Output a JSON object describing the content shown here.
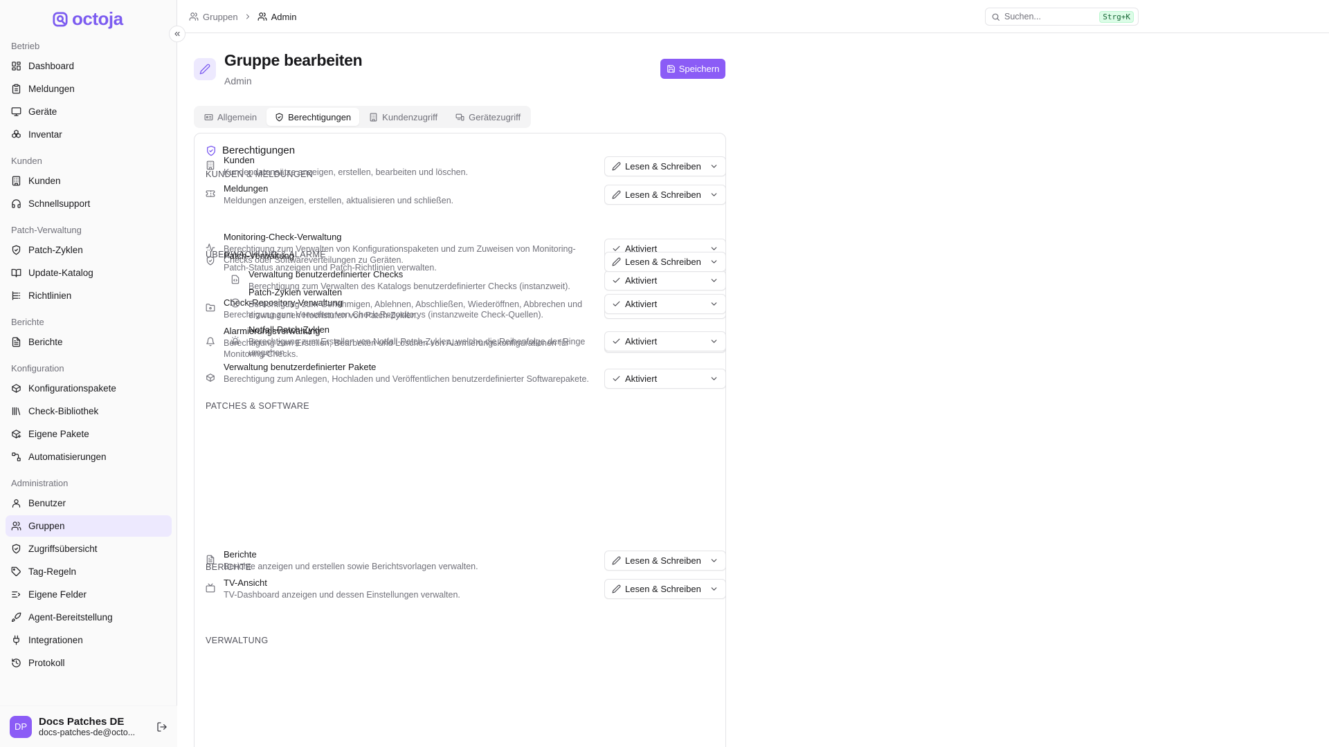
{
  "app": {
    "logo": "octoja"
  },
  "sidebar": {
    "sections": [
      {
        "title": "Betrieb",
        "items": [
          {
            "label": "Dashboard",
            "icon": "dashboard-icon"
          },
          {
            "label": "Meldungen",
            "icon": "clipboard-icon"
          },
          {
            "label": "Geräte",
            "icon": "monitor-icon"
          },
          {
            "label": "Inventar",
            "icon": "boxes-icon"
          }
        ]
      },
      {
        "title": "Kunden",
        "items": [
          {
            "label": "Kunden",
            "icon": "building-icon"
          },
          {
            "label": "Schnellsupport",
            "icon": "headset-icon"
          }
        ]
      },
      {
        "title": "Patch-Verwaltung",
        "items": [
          {
            "label": "Patch-Zyklen",
            "icon": "shield-icon"
          },
          {
            "label": "Update-Katalog",
            "icon": "book-icon"
          },
          {
            "label": "Richtlinien",
            "icon": "list-icon"
          }
        ]
      },
      {
        "title": "Berichte",
        "items": [
          {
            "label": "Berichte",
            "icon": "report-icon"
          }
        ]
      },
      {
        "title": "Konfiguration",
        "items": [
          {
            "label": "Konfigurationspakete",
            "icon": "package-icon"
          },
          {
            "label": "Check-Bibliothek",
            "icon": "library-icon"
          },
          {
            "label": "Eigene Pakete",
            "icon": "package-plus-icon"
          },
          {
            "label": "Automatisierungen",
            "icon": "workflow-icon"
          }
        ]
      },
      {
        "title": "Administration",
        "items": [
          {
            "label": "Benutzer",
            "icon": "user-icon"
          },
          {
            "label": "Gruppen",
            "icon": "users-icon",
            "active": true
          },
          {
            "label": "Zugriffsübersicht",
            "icon": "shield-icon"
          },
          {
            "label": "Tag-Regeln",
            "icon": "tag-icon"
          },
          {
            "label": "Eigene Felder",
            "icon": "fields-icon"
          },
          {
            "label": "Agent-Bereitstellung",
            "icon": "rocket-icon"
          },
          {
            "label": "Integrationen",
            "icon": "plug-icon"
          },
          {
            "label": "Protokoll",
            "icon": "history-icon"
          }
        ]
      }
    ],
    "user": {
      "initials": "DP",
      "name": "Docs Patches DE",
      "email": "docs-patches-de@octo..."
    }
  },
  "topbar": {
    "breadcrumb": [
      "Gruppen",
      "Admin"
    ],
    "search": {
      "placeholder": "Suchen...",
      "shortcut": "Strg+K"
    }
  },
  "header": {
    "title": "Gruppe bearbeiten",
    "subtitle": "Admin",
    "save_label": "Speichern"
  },
  "tabs": [
    {
      "label": "Allgemein",
      "icon": "id-card-icon"
    },
    {
      "label": "Berechtigungen",
      "icon": "shield-check-icon",
      "active": true
    },
    {
      "label": "Kundenzugriff",
      "icon": "building-icon"
    },
    {
      "label": "Gerätezugriff",
      "icon": "devices-icon"
    }
  ],
  "permissions": {
    "title": "Berechtigungen",
    "sections": [
      {
        "title": "KUNDEN & MELDUNGEN",
        "rows": [
          {
            "name": "Kunden",
            "desc": "Kundendatensätze anzeigen, erstellen, bearbeiten und löschen.",
            "value": "Lesen & Schreiben",
            "icon": "building-icon"
          },
          {
            "name": "Meldungen",
            "desc": "Meldungen anzeigen, erstellen, aktualisieren und schließen.",
            "value": "Lesen & Schreiben",
            "icon": "ticket-icon"
          }
        ]
      },
      {
        "title": "ÜBERWACHUNG & ALARME",
        "rows": [
          {
            "name": "Monitoring-Check-Verwaltung",
            "desc": "Berechtigung zum Verwalten von Konfigurationspaketen und zum Zuweisen von Monitoring-Checks oder Softwareverteilungen zu Geräten.",
            "value": "Aktiviert",
            "icon": "activity-icon"
          },
          {
            "name": "Verwaltung benutzerdefinierter Checks",
            "desc": "Berechtigung zum Verwalten des Katalogs benutzerdefinierter Checks (instanzweit).",
            "value": "Aktiviert",
            "icon": "file-code-icon",
            "sub": true
          },
          {
            "name": "Check-Repository-Verwaltung",
            "desc": "Berechtigung zum Verwalten von Check-Repositorys (instanzweite Check-Quellen).",
            "value": "Aktiviert",
            "icon": "folder-git-icon"
          },
          {
            "name": "Alarmierungsverwaltung",
            "desc": "Berechtigung zum Erstellen, Bearbeiten und Löschen von Alarmierungskonfigurationen für Monitoring-Checks.",
            "value": "Aktiviert",
            "icon": "bell-icon"
          }
        ]
      },
      {
        "title": "PATCHES & SOFTWARE",
        "rows": [
          {
            "name": "Patch-Verwaltung",
            "desc": "Patch-Status anzeigen und Patch-Richtlinien verwalten.",
            "value": "Lesen & Schreiben",
            "icon": "shield-icon"
          },
          {
            "name": "Patch-Zyklen verwalten",
            "desc": "Berechtigung zum Genehmigen, Ablehnen, Abschließen, Wiederöffnen, Abbrechen und erzwungenen Hochstufen von Patch-Zyklen.",
            "value": "Aktiviert",
            "icon": "circle-check-icon",
            "sub": true
          },
          {
            "name": "Notfall-Patch-Zyklen",
            "desc": "Berechtigung zum Erstellen von Notfall-Patch-Zyklen, welche die Reihenfolge der Ringe umgehen.",
            "value": "Aktiviert",
            "icon": "siren-icon",
            "sub": true
          },
          {
            "name": "Verwaltung benutzerdefinierter Pakete",
            "desc": "Berechtigung zum Anlegen, Hochladen und Veröffentlichen benutzerdefinierter Softwarepakete.",
            "value": "Aktiviert",
            "icon": "package-icon"
          }
        ]
      },
      {
        "title": "BERICHTE",
        "rows": [
          {
            "name": "Berichte",
            "desc": "Berichte anzeigen und erstellen sowie Berichtsvorlagen verwalten.",
            "value": "Lesen & Schreiben",
            "icon": "report-icon"
          },
          {
            "name": "TV-Ansicht",
            "desc": "TV-Dashboard anzeigen und dessen Einstellungen verwalten.",
            "value": "Lesen & Schreiben",
            "icon": "tv-icon"
          }
        ]
      },
      {
        "title": "VERWALTUNG",
        "rows": []
      }
    ]
  },
  "colors": {
    "accent": "#8b5cf6",
    "accent_soft": "#ede9fe",
    "border": "#e4e4e7",
    "muted": "#71717a"
  }
}
